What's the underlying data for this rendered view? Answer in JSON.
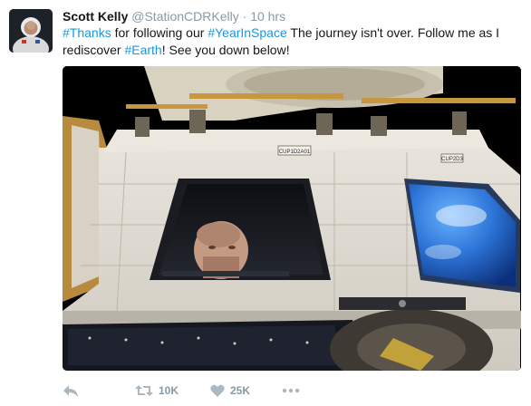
{
  "user": {
    "name": "Scott Kelly",
    "handle": "@StationCDRKelly",
    "separator": "·",
    "time": "10 hrs"
  },
  "tweet": {
    "segments": [
      {
        "text": "#Thanks",
        "type": "hashtag"
      },
      {
        "text": " for following our ",
        "type": "text"
      },
      {
        "text": "#YearInSpace",
        "type": "hashtag"
      },
      {
        "text": " The journey isn't over. Follow me as I rediscover ",
        "type": "text"
      },
      {
        "text": "#Earth",
        "type": "hashtag"
      },
      {
        "text": "! See you down below!",
        "type": "text"
      }
    ]
  },
  "media": {
    "panel_labels": [
      "CUP1D2A01",
      "CUP2D3"
    ]
  },
  "actions": {
    "retweet_count": "10K",
    "like_count": "25K"
  },
  "colors": {
    "hashtag": "#1b95e0",
    "muted": "#8899a6",
    "text": "#14171a"
  },
  "icons": [
    "reply-icon",
    "retweet-icon",
    "like-icon",
    "more-icon"
  ]
}
